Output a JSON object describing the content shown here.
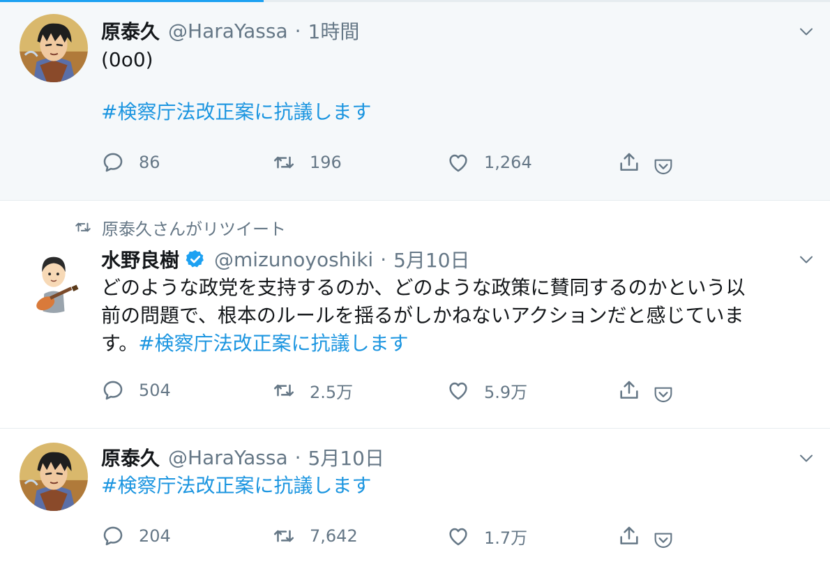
{
  "colors": {
    "accent": "#1da1f2",
    "hashtag": "#1b95e0",
    "muted": "#657786"
  },
  "tweets": [
    {
      "author_name": "原泰久",
      "handle": "@HaraYassa",
      "separator": "·",
      "time": "1時間",
      "text_line1": "(0o0)",
      "hashtag": "#検察庁法改正案に抗議します",
      "replies": "86",
      "retweets": "196",
      "likes": "1,264",
      "avatar": "manga-character-avatar"
    },
    {
      "retweet_context": "原泰久さんがリツイート",
      "author_name": "水野良樹",
      "verified": true,
      "handle": "@mizunoyoshiki",
      "separator": "·",
      "time": "5月10日",
      "text_line1": "どのような政党を支持するのか、どのような政策に賛同するのかという以",
      "text_line2": "前の問題で、根本のルールを揺るがしかねないアクションだと感じていま",
      "text_line3_prefix": "す。",
      "hashtag": "#検察庁法改正案に抗議します",
      "replies": "504",
      "retweets": "2.5万",
      "likes": "5.9万",
      "avatar": "guitarist-illustration-avatar"
    },
    {
      "author_name": "原泰久",
      "handle": "@HaraYassa",
      "separator": "·",
      "time": "5月10日",
      "hashtag": "#検察庁法改正案に抗議します",
      "replies": "204",
      "retweets": "7,642",
      "likes": "1.7万",
      "avatar": "manga-character-avatar"
    }
  ]
}
